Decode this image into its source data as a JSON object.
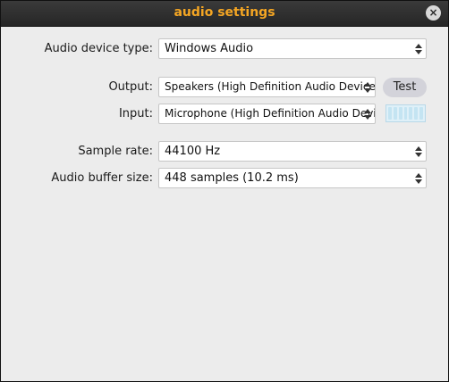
{
  "window": {
    "title": "audio settings",
    "close_glyph": "×"
  },
  "device_type": {
    "label": "Audio device type:",
    "value": "Windows Audio"
  },
  "output": {
    "label": "Output:",
    "value": "Speakers (High Definition Audio Device)",
    "test_label": "Test"
  },
  "input": {
    "label": "Input:",
    "value": "Microphone (High Definition Audio Device)",
    "level": 0
  },
  "sample_rate": {
    "label": "Sample rate:",
    "value": "44100 Hz"
  },
  "buffer_size": {
    "label": "Audio buffer size:",
    "value": "448 samples (10.2 ms)"
  },
  "colors": {
    "title": "#f5a623",
    "background": "#ececec",
    "titlebar": "#2e2e2e"
  },
  "icons": {
    "close": "close-icon",
    "dropdown": "chevron-updown-icon"
  }
}
